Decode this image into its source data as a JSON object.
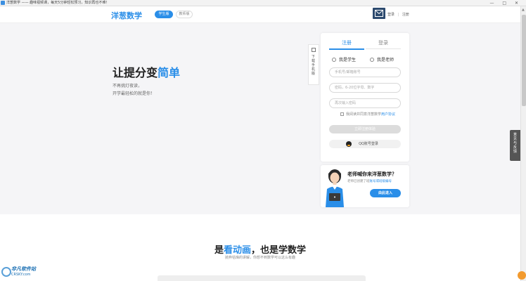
{
  "window": {
    "title": "洋葱数学 —— 趣味视频课，每天5分钟轻松预习，知识再也不难！",
    "controls": "— □ ✕"
  },
  "header": {
    "logo": "洋葱数学",
    "tab_student": "学生版",
    "tab_teacher": "教师版",
    "login": "登录",
    "separator": "|",
    "register": "注册"
  },
  "hero": {
    "headline_prefix": "让提分变",
    "headline_accent": "简单",
    "subline_1": "不再挑灯夜读，",
    "subline_2": "开学最轻松的就是你！",
    "download_label": "下载手机版"
  },
  "card": {
    "tab_register": "注册",
    "tab_login": "登录",
    "role_student": "我是学生",
    "role_teacher": "我是老师",
    "phone_placeholder": "手机号/邮箱账号",
    "password_placeholder": "密码，6-20位字母、数字",
    "confirm_placeholder": "再次输入密码",
    "agree_text": "我阅读并同意洋葱数学",
    "agree_link": "用户协议",
    "submit": "立即注册体验",
    "qq_login": "QQ账号登录"
  },
  "promo": {
    "title": "老师喊你来洋葱数学？",
    "desc_prefix": "老师已创建了班",
    "desc_link": "账号或班级编号",
    "button": "由此进入"
  },
  "feedback": {
    "label": "意见与反馈"
  },
  "section2": {
    "title_prefix": "是",
    "title_accent": "看动画",
    "title_suffix": "，也是学数学",
    "subtitle": "抛弃枯燥的讲解，你想不到数学可以这么有趣"
  },
  "watermark": {
    "text": "非凡软件站",
    "sub": "CRSKY.com"
  },
  "colors": {
    "accent": "#2a8ee8",
    "hero_bg": "#f5f5f7"
  }
}
